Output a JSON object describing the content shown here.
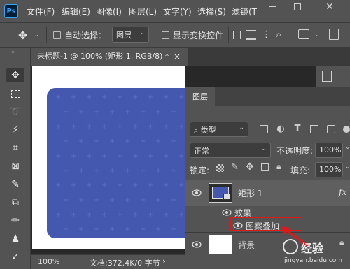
{
  "app": {
    "logo": "Ps"
  },
  "menu": [
    "文件(F)",
    "编辑(E)",
    "图像(I)",
    "图层(L)",
    "文字(Y)",
    "选择(S)",
    "滤镜(T"
  ],
  "options": {
    "auto_select_label": "自动选择：",
    "auto_select_value": "图层",
    "show_transform_label": "显示变换控件"
  },
  "tab": {
    "title": "未标题-1 @ 100% (矩形 1, RGB/8) *",
    "close": "×"
  },
  "status": {
    "zoom": "100%",
    "doc_info": "文档:372.4K/0 字节"
  },
  "layers_panel": {
    "tab_label": "图层",
    "filter_label": "类型",
    "blend_mode": "正常",
    "opacity_label": "不透明度:",
    "opacity_value": "100%",
    "lock_label": "锁定:",
    "fill_label": "填充:",
    "fill_value": "100%",
    "layers": [
      {
        "name": "矩形 1",
        "fx": "fx",
        "effects_label": "效果",
        "effect_name": "图案叠加"
      },
      {
        "name": "背景"
      }
    ]
  },
  "watermark": {
    "text": "经验",
    "url": "jingyan.baidu.com"
  },
  "colors": {
    "shape": "#4458b0",
    "highlight": "#e01818",
    "ui": "#535353"
  },
  "icons": [
    "move-tool-icon",
    "marquee-icon",
    "lasso-icon",
    "magic-wand-icon",
    "crop-icon",
    "frame-icon",
    "eyedropper-icon",
    "spot-heal-icon",
    "brush-icon",
    "stamp-icon",
    "history-brush-icon",
    "eye-icon",
    "lock-icon",
    "search-icon",
    "gear-icon"
  ]
}
